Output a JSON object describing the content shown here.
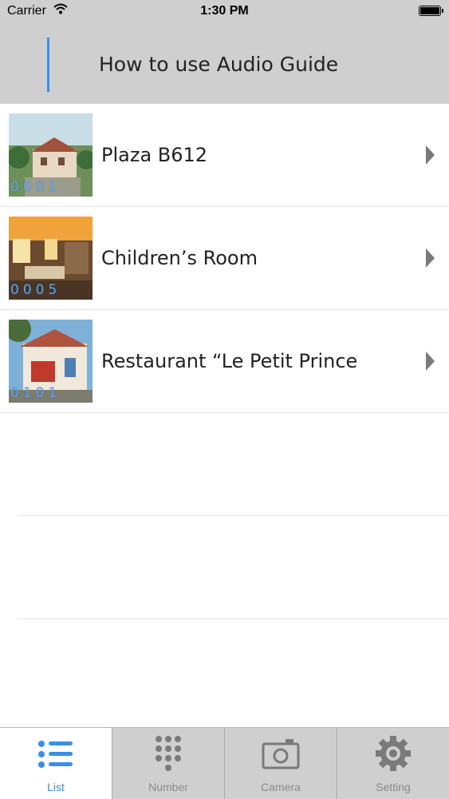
{
  "status": {
    "carrier": "Carrier",
    "time": "1:30 PM"
  },
  "header": {
    "title": "How to use Audio Guide"
  },
  "items": [
    {
      "code": "0001",
      "label": "Plaza B612"
    },
    {
      "code": "0005",
      "label": "Children’s Room"
    },
    {
      "code": "0101",
      "label": "Restaurant “Le Petit Prince"
    }
  ],
  "tabs": [
    {
      "label": "List",
      "icon": "list-icon",
      "active": true
    },
    {
      "label": "Number",
      "icon": "keypad-icon",
      "active": false
    },
    {
      "label": "Camera",
      "icon": "camera-icon",
      "active": false
    },
    {
      "label": "Setting",
      "icon": "gear-icon",
      "active": false
    }
  ],
  "colors": {
    "accent": "#3a8ee6",
    "bar": "#cfcfcf",
    "inactive": "#8a8a8a"
  }
}
